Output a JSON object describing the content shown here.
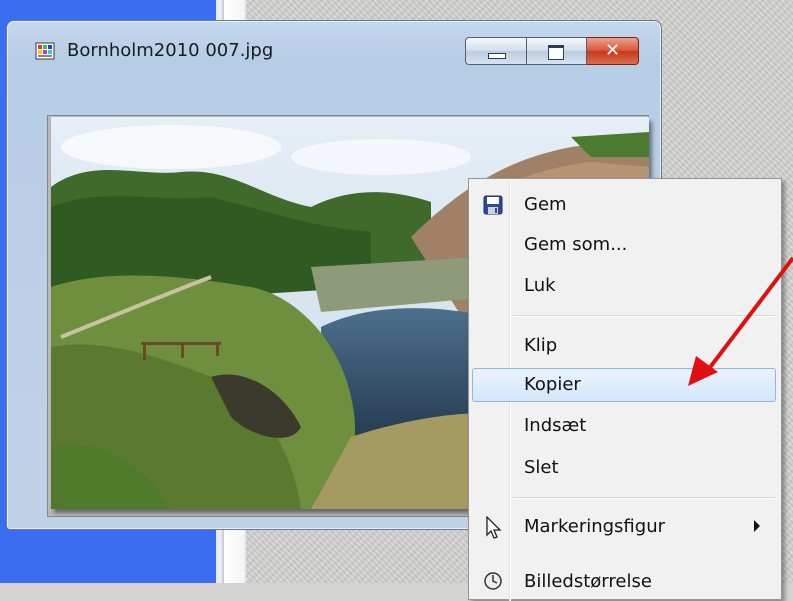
{
  "window": {
    "title": "Bornholm2010 007.jpg",
    "icon": "image-file-icon",
    "buttons": {
      "minimize": "minimize-icon",
      "maximize": "maximize-icon",
      "close": "✕"
    }
  },
  "context_menu": {
    "items": [
      {
        "label": "Gem",
        "icon": "save-icon"
      },
      {
        "label": "Gem som..."
      },
      {
        "label": "Luk"
      },
      {
        "label": "Klip"
      },
      {
        "label": "Kopier",
        "highlighted": true
      },
      {
        "label": "Indsæt"
      },
      {
        "label": "Slet"
      },
      {
        "label": "Markeringsfigur",
        "icon": "cursor-icon",
        "submenu": true
      },
      {
        "label": "Billedstørrelse",
        "icon": "image-size-icon",
        "partially_visible": true
      }
    ]
  },
  "colors": {
    "desktop_strip": "#3a6df0",
    "highlight": "#d4e6fa",
    "annotation_arrow": "#e01010"
  }
}
